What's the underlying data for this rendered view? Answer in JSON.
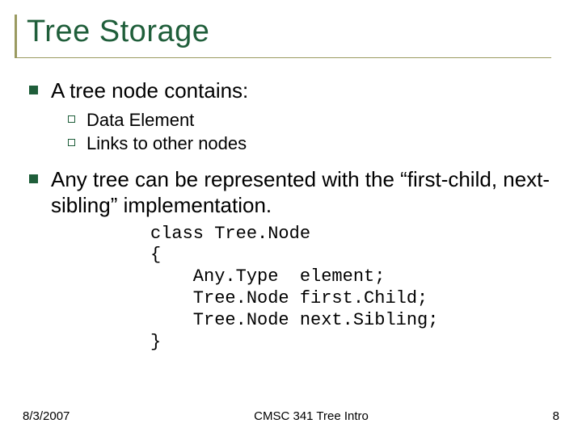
{
  "title": "Tree Storage",
  "bullets": [
    {
      "text": "A tree node contains:",
      "sub": [
        "Data Element",
        "Links to other nodes"
      ]
    },
    {
      "text": "Any tree can be represented with the “first-child, next-sibling” implementation.",
      "sub": []
    }
  ],
  "code": "class Tree.Node\n{\n    Any.Type  element;\n    Tree.Node first.Child;\n    Tree.Node next.Sibling;\n}",
  "footer": {
    "date": "8/3/2007",
    "course": "CMSC 341 Tree Intro",
    "page": "8"
  }
}
